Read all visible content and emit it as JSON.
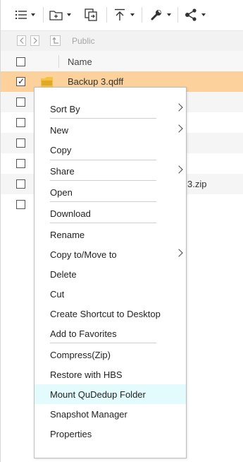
{
  "toolbar": {
    "buttons": [
      {
        "icon": "list-view-icon",
        "has_dropdown": true
      },
      {
        "icon": "add-folder-icon",
        "has_dropdown": true
      },
      {
        "icon": "copy-files-icon",
        "has_dropdown": false
      },
      {
        "icon": "upload-icon",
        "has_dropdown": true
      },
      {
        "icon": "wrench-icon",
        "has_dropdown": true
      },
      {
        "icon": "share-icon",
        "has_dropdown": true
      }
    ]
  },
  "pathbar": {
    "back_icon": "chevron-left-icon",
    "forward_icon": "chevron-right-icon",
    "up_icon": "folder-up-icon",
    "current_path": "Public"
  },
  "file_list": {
    "columns": [
      "Name"
    ],
    "rows": [
      {
        "name": "Backup 3.qdff",
        "checked": true,
        "selected": true,
        "icon_label": "QDFF"
      },
      {
        "name": "",
        "checked": false
      },
      {
        "name": "",
        "checked": false
      },
      {
        "name": "",
        "checked": false
      },
      {
        "name": "",
        "checked": false
      },
      {
        "name": "3.zip",
        "checked": false
      },
      {
        "name": "",
        "checked": false
      }
    ]
  },
  "context_menu": {
    "items": [
      {
        "label": "Sort By",
        "submenu": true
      },
      {
        "label": "New",
        "submenu": true
      },
      {
        "label": "Copy",
        "submenu": false
      },
      {
        "label": "Share",
        "submenu": true
      },
      {
        "label": "Open",
        "submenu": false
      },
      {
        "label": "Download",
        "submenu": false
      },
      {
        "label": "Rename",
        "submenu": false
      },
      {
        "label": "Copy to/Move to",
        "submenu": true
      },
      {
        "label": "Delete",
        "submenu": false
      },
      {
        "label": "Cut",
        "submenu": false
      },
      {
        "label": "Create Shortcut to Desktop",
        "submenu": false
      },
      {
        "label": "Add to Favorites",
        "submenu": false
      },
      {
        "label": "Compress(Zip)",
        "submenu": false
      },
      {
        "label": "Restore with HBS",
        "submenu": false
      },
      {
        "label": "Mount QuDedup Folder",
        "submenu": false,
        "highlighted": true
      },
      {
        "label": "Snapshot Manager",
        "submenu": false
      },
      {
        "label": "Properties",
        "submenu": false
      }
    ]
  },
  "colors": {
    "selected_row": "#fcd19c",
    "menu_highlight": "#e3fbfd",
    "folder_icon": "#f5c33b"
  }
}
